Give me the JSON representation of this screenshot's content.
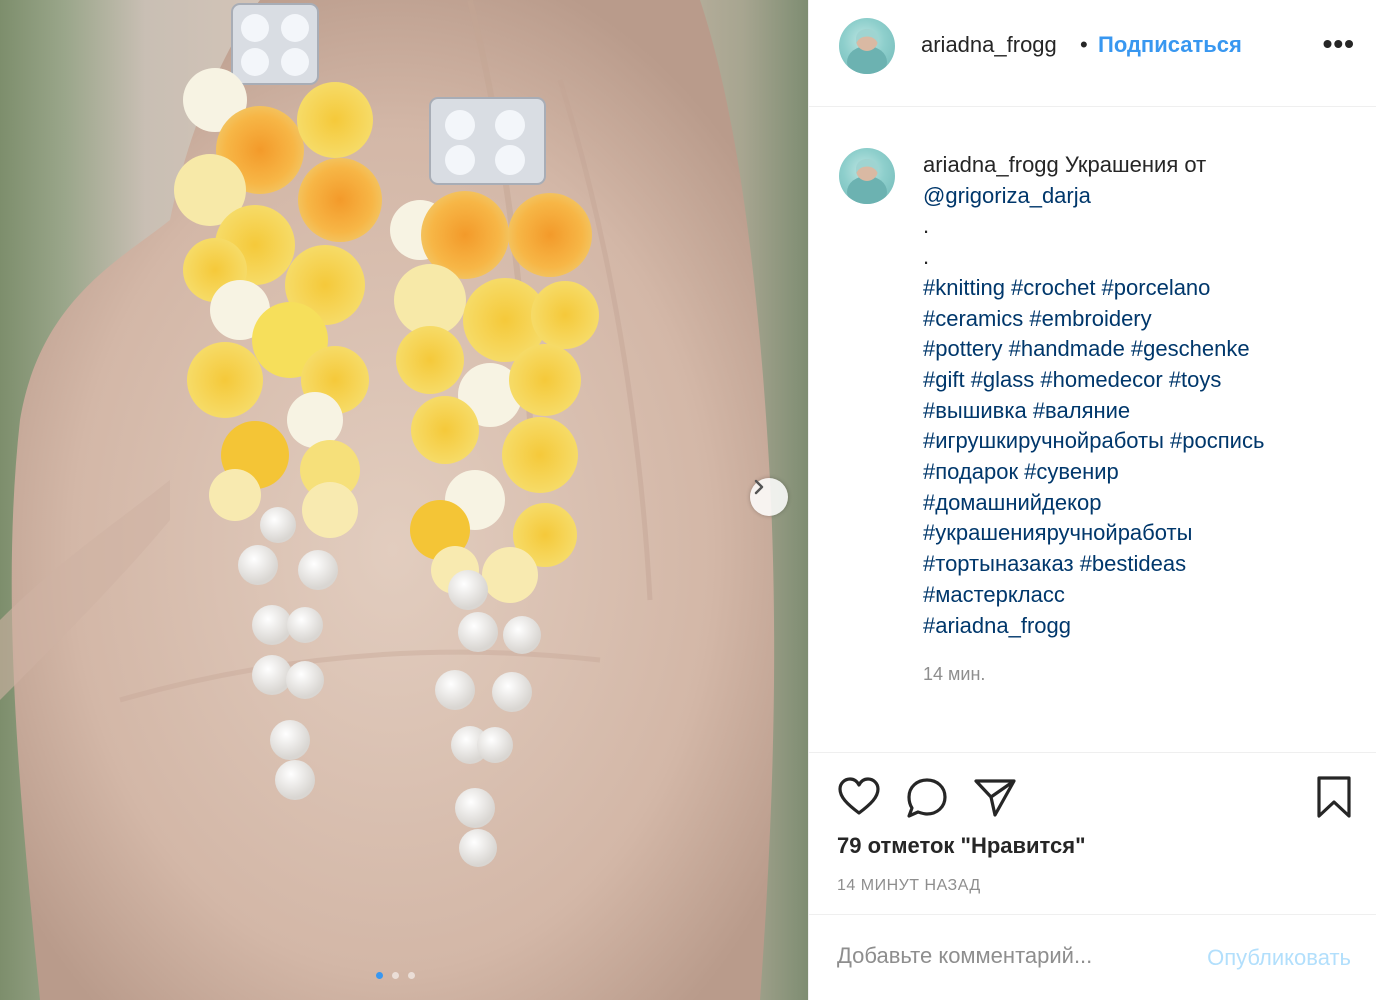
{
  "post": {
    "username": "ariadna_frogg",
    "separator": "•",
    "follow_label": "Подписаться",
    "more_label": "•••"
  },
  "caption": {
    "username": "ariadna_frogg",
    "text": "Украшения от",
    "mention": "@grigoriza_darja",
    "dot_lines": [
      ".",
      "."
    ],
    "hashtag_lines": [
      "#knitting #crochet #porcelano",
      "#ceramics #embroidery",
      "#pottery #handmade #geschenke",
      "#gift #glass #homedecor #toys",
      "#вышивка #валяние",
      "#игрушкиручнойработы #роспись",
      "#подарок #сувенир",
      "#домашнийдекор",
      "#украшенияручнойработы",
      "#тортыназаказ #bestideas",
      "#мастеркласс",
      "#ariadna_frogg"
    ],
    "time": "14 мин."
  },
  "actions": {
    "icons": [
      "heart-icon",
      "comment-icon",
      "share-icon",
      "bookmark-icon"
    ],
    "likes_text": "79 отметок \"Нравится\"",
    "time_ago": "14 МИНУТ НАЗАД"
  },
  "comment": {
    "placeholder": "Добавьте комментарий...",
    "post_label": "Опубликовать"
  },
  "carousel": {
    "slide_count": 3,
    "active_index": 0,
    "next_icon": "chevron-right-icon"
  },
  "colors": {
    "accent": "#3897f0",
    "link": "#00376b",
    "muted": "#8e8e8e",
    "post_disabled": "#b2dffc"
  }
}
